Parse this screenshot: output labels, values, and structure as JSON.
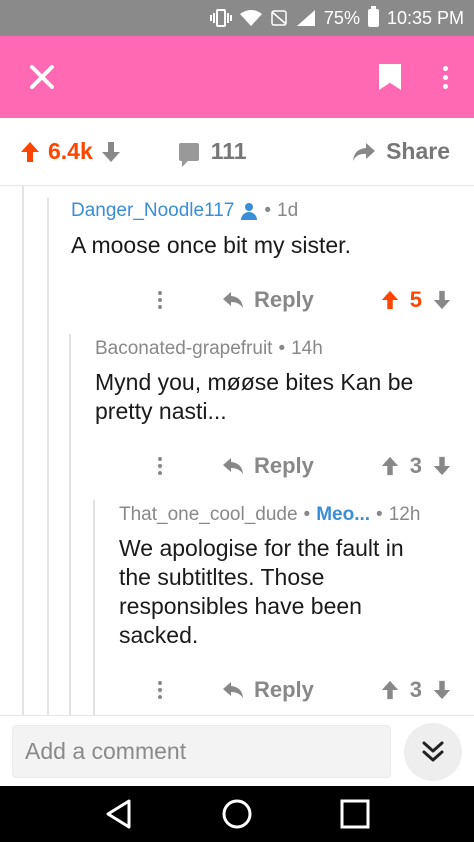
{
  "status_bar": {
    "battery": "75%",
    "time": "10:35 PM"
  },
  "post_actions": {
    "score": "6.4k",
    "comment_count": "111",
    "share_label": "Share"
  },
  "comments": [
    {
      "author": "Danger_Noodle117",
      "age": "1d",
      "body": "A moose once bit my sister.",
      "reply_label": "Reply",
      "score": "5",
      "upvoted": true
    },
    {
      "author": "Baconated-grapefruit",
      "age": "14h",
      "body": "Mynd you, møøse bites Kan be pretty nasti...",
      "reply_label": "Reply",
      "score": "3",
      "upvoted": false
    },
    {
      "author": "That_one_cool_dude",
      "flair": "Meo...",
      "age": "12h",
      "body": "We apologise for the fault in the subtitltes. Those responsibles have been sacked.",
      "reply_label": "Reply",
      "score": "3",
      "upvoted": false
    }
  ],
  "comment_box": {
    "placeholder": "Add a comment"
  },
  "separator": "•",
  "colors": {
    "app_bar": "#ff69b4",
    "upvote": "#ff4500",
    "author_link": "#3a8ed8",
    "status_bar": "#8a8a8a"
  }
}
